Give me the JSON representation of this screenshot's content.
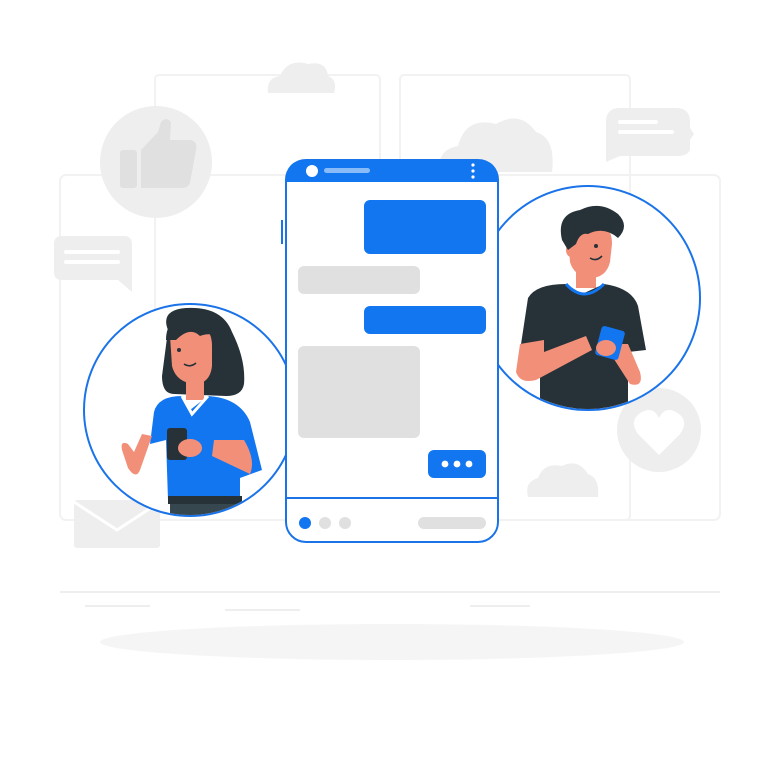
{
  "illustration": {
    "theme": "messaging-app-chat",
    "colors": {
      "accent_blue": "#1a73e8",
      "bubble_blue": "#1276f0",
      "bubble_gray": "#e0e0e0",
      "background_shape": "#f5f5f5",
      "icon_gray": "#e6e6e6",
      "hair_dark": "#263238",
      "skin": "#f28f79",
      "shirt_dark": "#263238",
      "shirt_blue": "#1276f0"
    },
    "icons": [
      "thumbs-up-icon",
      "cloud-icon",
      "speech-bubble-icon",
      "heart-icon",
      "envelope-icon",
      "typing-dots-icon"
    ],
    "phone": {
      "messages": [
        {
          "side": "right",
          "style": "blue"
        },
        {
          "side": "left",
          "style": "gray"
        },
        {
          "side": "right",
          "style": "blue"
        },
        {
          "side": "left",
          "style": "gray-block"
        },
        {
          "side": "right",
          "style": "typing"
        }
      ],
      "pager_dots": 3,
      "active_dot": 1
    }
  }
}
